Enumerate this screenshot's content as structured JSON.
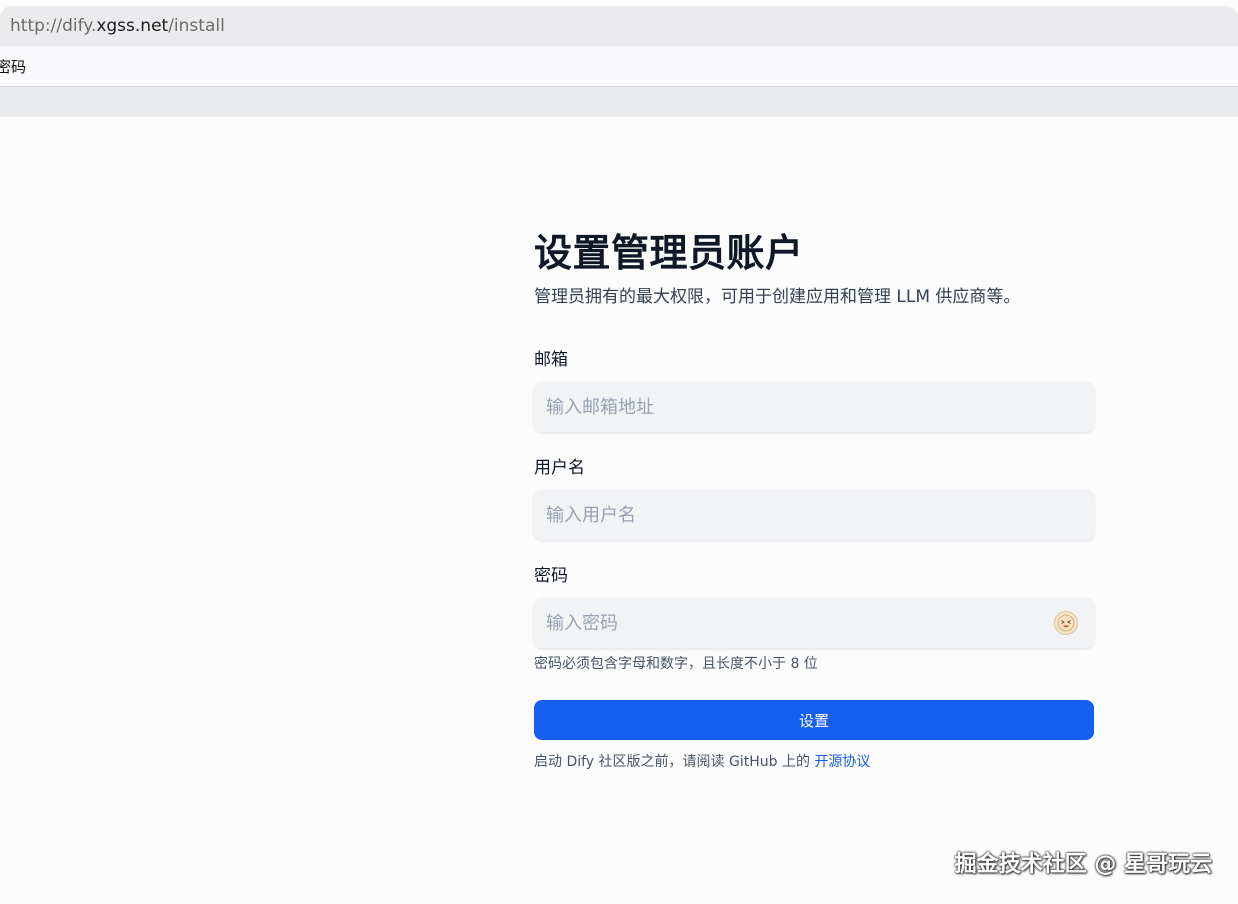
{
  "browser": {
    "url_prefix": "http://dify.",
    "url_host": "xgss.net",
    "url_path": "/install",
    "tab_title": "密码"
  },
  "form": {
    "title": "设置管理员账户",
    "subtitle": "管理员拥有的最大权限，可用于创建应用和管理 LLM 供应商等。",
    "email": {
      "label": "邮箱",
      "placeholder": "输入邮箱地址",
      "value": ""
    },
    "username": {
      "label": "用户名",
      "placeholder": "输入用户名",
      "value": ""
    },
    "password": {
      "label": "密码",
      "placeholder": "输入密码",
      "value": "",
      "hint": "密码必须包含字母和数字，且长度不小于 8 位",
      "toggle_icon": "emoji-hide-icon"
    },
    "submit_label": "设置",
    "footer_text": "启动 Dify 社区版之前，请阅读 GitHub 上的 ",
    "footer_link": "开源协议"
  },
  "watermark": "掘金技术社区 @ 星哥玩云",
  "colors": {
    "accent": "#155eef",
    "input_bg": "#f2f3f5",
    "page_bg": "#fcfcfd"
  }
}
